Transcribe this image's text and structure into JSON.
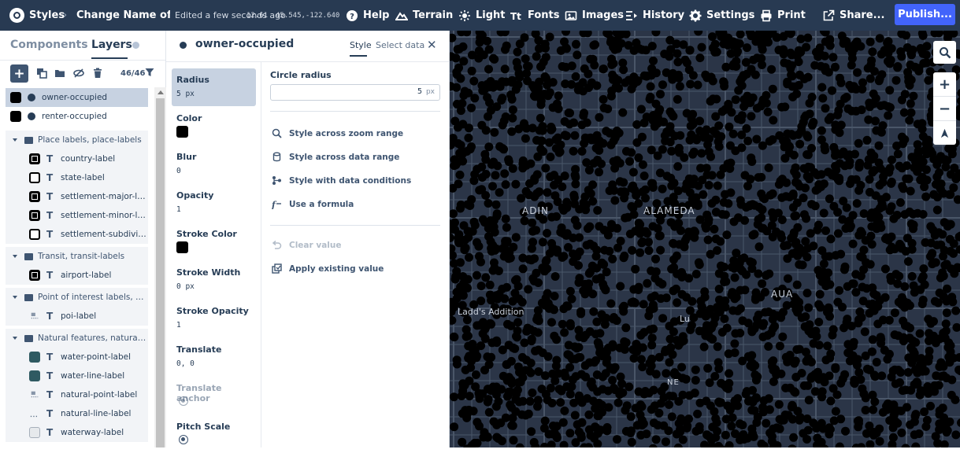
{
  "topbar": {
    "styles_label": "Styles",
    "style_name": "Change Name of S...",
    "edited": "Edited a few seconds ago",
    "zoom": "12.61",
    "coords": "45.545,-122.640",
    "help": "Help",
    "terrain": "Terrain",
    "light": "Light",
    "fonts": "Fonts",
    "images": "Images",
    "history": "History",
    "settings": "Settings",
    "print": "Print",
    "share": "Share...",
    "publish": "Publish..."
  },
  "left": {
    "tab_components": "Components",
    "tab_layers": "Layers",
    "count": "46/46",
    "layers": [
      {
        "name": "owner-occupied",
        "kind": "circle",
        "selected": true
      },
      {
        "name": "renter-occupied",
        "kind": "circle"
      },
      {
        "group": "Place labels, place-labels"
      },
      {
        "name": "country-label",
        "kind": "symbol",
        "swatch": "icon"
      },
      {
        "name": "state-label",
        "kind": "symbol",
        "swatch": "outline"
      },
      {
        "name": "settlement-major-la...",
        "kind": "symbol",
        "swatch": "icon"
      },
      {
        "name": "settlement-minor-la...",
        "kind": "symbol",
        "swatch": "icon"
      },
      {
        "name": "settlement-subdivisi...",
        "kind": "symbol",
        "swatch": "outline"
      },
      {
        "group": "Transit, transit-labels"
      },
      {
        "name": "airport-label",
        "kind": "symbol",
        "swatch": "icon"
      },
      {
        "group": "Point of interest labels, poi-l..."
      },
      {
        "name": "poi-label",
        "kind": "symbol",
        "swatch": "none"
      },
      {
        "group": "Natural features, natural-la..."
      },
      {
        "name": "water-point-label",
        "kind": "symbol",
        "swatch": "teal"
      },
      {
        "name": "water-line-label",
        "kind": "symbol",
        "swatch": "teal"
      },
      {
        "name": "natural-point-label",
        "kind": "symbol",
        "swatch": "none"
      },
      {
        "name": "natural-line-label",
        "kind": "symbol",
        "swatch": "dots"
      },
      {
        "name": "waterway-label",
        "kind": "symbol",
        "swatch": "light"
      }
    ]
  },
  "panel": {
    "title": "owner-occupied",
    "tab_style": "Style",
    "tab_select": "Select data",
    "close": "✕",
    "properties": [
      {
        "name": "Radius",
        "value": "5 px",
        "selected": true
      },
      {
        "name": "Color",
        "swatch": "#000000"
      },
      {
        "name": "Blur",
        "value": "0"
      },
      {
        "name": "Opacity",
        "value": "1"
      },
      {
        "name": "Stroke Color",
        "swatch": "#000000"
      },
      {
        "name": "Stroke Width",
        "value": "0 px"
      },
      {
        "name": "Stroke Opacity",
        "value": "1"
      },
      {
        "name": "Translate",
        "value": "0, 0"
      },
      {
        "name": "Translate anchor",
        "muted": true,
        "icon": "globe-icon"
      },
      {
        "name": "Pitch Scale",
        "icon": "globe-icon"
      }
    ],
    "circle_radius": {
      "label": "Circle radius",
      "value": "5",
      "unit": "px"
    },
    "options": {
      "zoom": "Style across zoom range",
      "data": "Style across data range",
      "conditions": "Style with data conditions",
      "formula": "Use a formula",
      "clear": "Clear value",
      "existing": "Apply existing value"
    }
  },
  "map": {
    "labels": [
      "ADIN",
      "ALAMEDA",
      "Ladd's Addition",
      "Lu",
      "AUA",
      "NE"
    ],
    "colors": {
      "background": "#2b3547",
      "dots": "#000000",
      "roads": "#4a5668"
    }
  }
}
